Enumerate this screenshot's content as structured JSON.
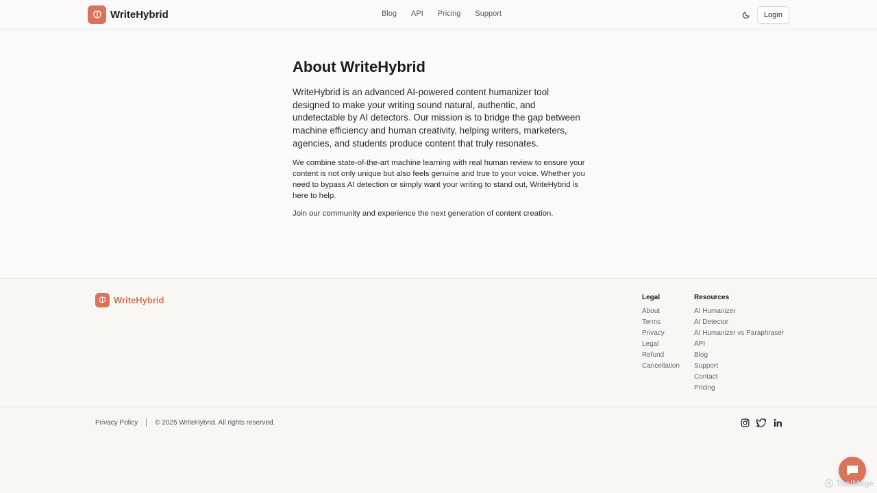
{
  "header": {
    "brand": "WriteHybrid",
    "nav": [
      "Blog",
      "API",
      "Pricing",
      "Support"
    ],
    "login_label": "Login"
  },
  "main": {
    "title": "About WriteHybrid",
    "lead": "WriteHybrid is an advanced AI-powered content humanizer tool designed to make your writing sound natural, authentic, and undetectable by AI detectors. Our mission is to bridge the gap between machine efficiency and human creativity, helping writers, marketers, agencies, and students produce content that truly resonates.",
    "para1": "We combine state-of-the-art machine learning with real human review to ensure your content is not only unique but also feels genuine and true to your voice. Whether you need to bypass AI detection or simply want your writing to stand out, WriteHybrid is here to help.",
    "para2": "Join our community and experience the next generation of content creation."
  },
  "footer": {
    "brand": "WriteHybrid",
    "legal": {
      "title": "Legal",
      "items": [
        "About",
        "Terms",
        "Privacy",
        "Legal",
        "Refund",
        "Cancellation"
      ]
    },
    "resources": {
      "title": "Resources",
      "items": [
        "AI Humanizer",
        "AI Detector",
        "AI Humanizer vs Paraphraser",
        "API",
        "Blog",
        "Support",
        "Contact",
        "Pricing"
      ]
    },
    "privacy_policy": "Privacy Policy",
    "copyright": "© 2025 WriteHybrid. All rights reserved.",
    "socials": [
      "instagram-icon",
      "twitter-icon",
      "linkedin-icon"
    ]
  },
  "watermark": "ToolMage",
  "colors": {
    "brand": "#d9735b",
    "background": "#fbfaf8",
    "text": "#1c1c1c"
  }
}
